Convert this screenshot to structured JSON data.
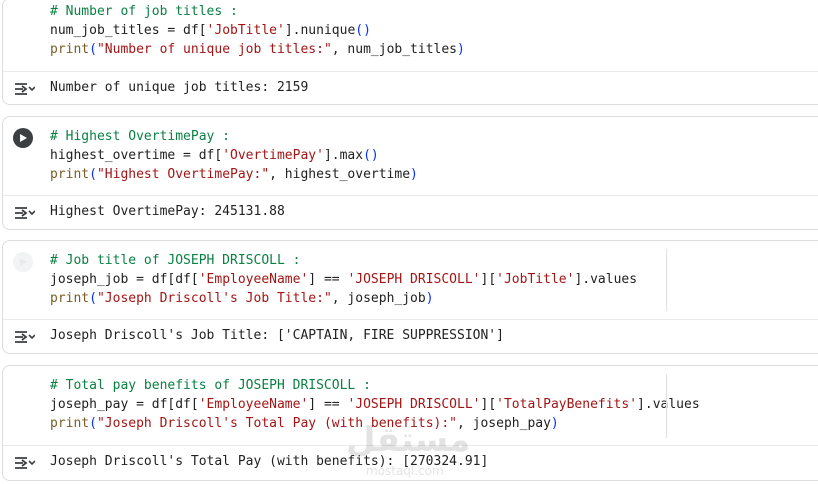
{
  "cells": [
    {
      "id": "job-titles",
      "lines": [
        [
          {
            "t": "comment",
            "v": "# Number of job titles :"
          }
        ],
        [
          {
            "t": "plain",
            "v": "num_job_titles = df["
          },
          {
            "t": "str",
            "v": "'JobTitle'"
          },
          {
            "t": "plain",
            "v": "].nunique"
          },
          {
            "t": "punc",
            "v": "()"
          }
        ],
        [
          {
            "t": "fn",
            "v": "print"
          },
          {
            "t": "punc",
            "v": "("
          },
          {
            "t": "str",
            "v": "\"Number of unique job titles:\""
          },
          {
            "t": "plain",
            "v": ", num_job_titles"
          },
          {
            "t": "punc",
            "v": ")"
          }
        ]
      ],
      "output": "Number of unique job titles: 2159"
    },
    {
      "id": "highest-overtime",
      "lines": [
        [
          {
            "t": "comment",
            "v": "# Highest OvertimePay :"
          }
        ],
        [
          {
            "t": "plain",
            "v": "highest_overtime = df["
          },
          {
            "t": "str",
            "v": "'OvertimePay'"
          },
          {
            "t": "plain",
            "v": "].max"
          },
          {
            "t": "punc",
            "v": "()"
          }
        ],
        [
          {
            "t": "fn",
            "v": "print"
          },
          {
            "t": "punc",
            "v": "("
          },
          {
            "t": "str",
            "v": "\"Highest OvertimePay:\""
          },
          {
            "t": "plain",
            "v": ", highest_overtime"
          },
          {
            "t": "punc",
            "v": ")"
          }
        ]
      ],
      "output": "Highest OvertimePay: 245131.88"
    },
    {
      "id": "joseph-job",
      "lines": [
        [
          {
            "t": "comment",
            "v": "# Job title of JOSEPH DRISCOLL :"
          }
        ],
        [
          {
            "t": "plain",
            "v": "joseph_job = df[df["
          },
          {
            "t": "str",
            "v": "'EmployeeName'"
          },
          {
            "t": "plain",
            "v": "] == "
          },
          {
            "t": "str",
            "v": "'JOSEPH DRISCOLL'"
          },
          {
            "t": "plain",
            "v": "]["
          },
          {
            "t": "str",
            "v": "'JobTitle'"
          },
          {
            "t": "plain",
            "v": "].values"
          }
        ],
        [
          {
            "t": "fn",
            "v": "print"
          },
          {
            "t": "punc",
            "v": "("
          },
          {
            "t": "str",
            "v": "\"Joseph Driscoll's Job Title:\""
          },
          {
            "t": "plain",
            "v": ", joseph_job"
          },
          {
            "t": "punc",
            "v": ")"
          }
        ]
      ],
      "output": "Joseph Driscoll's Job Title: ['CAPTAIN, FIRE SUPPRESSION']"
    },
    {
      "id": "joseph-pay",
      "lines": [
        [
          {
            "t": "comment",
            "v": "# Total pay benefits of JOSEPH DRISCOLL :"
          }
        ],
        [
          {
            "t": "plain",
            "v": "joseph_pay = df[df["
          },
          {
            "t": "str",
            "v": "'EmployeeName'"
          },
          {
            "t": "plain",
            "v": "] == "
          },
          {
            "t": "str",
            "v": "'JOSEPH DRISCOLL'"
          },
          {
            "t": "plain",
            "v": "]["
          },
          {
            "t": "str",
            "v": "'TotalPayBenefits'"
          },
          {
            "t": "plain",
            "v": "].values"
          }
        ],
        [
          {
            "t": "fn",
            "v": "print"
          },
          {
            "t": "punc",
            "v": "("
          },
          {
            "t": "str",
            "v": "\"Joseph Driscoll's Total Pay (with benefits):\""
          },
          {
            "t": "plain",
            "v": ", joseph_pay"
          },
          {
            "t": "punc",
            "v": ")"
          }
        ]
      ],
      "output": "Joseph Driscoll's Total Pay (with benefits): [270324.91]"
    }
  ],
  "watermark": {
    "main": "مستقل",
    "sub": "mostaql.com"
  },
  "icons": {
    "run": "play-icon",
    "output": "output-toggle-icon"
  }
}
